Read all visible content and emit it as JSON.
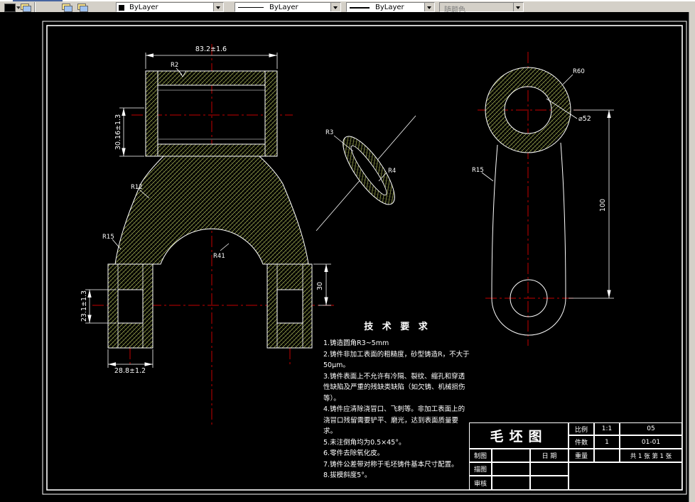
{
  "toolbar": {
    "layer_combo": {
      "label": "ByLayer"
    },
    "linetype_combo": {
      "label": "ByLayer"
    },
    "lineweight_combo": {
      "label": "ByLayer"
    },
    "plotstyle_combo": {
      "label": "随颜色"
    }
  },
  "colors": {
    "centerline": "#c40000",
    "hatch": "#98a24e",
    "outline": "#ffffff",
    "toolbar_bg": "#d4d0c8"
  },
  "tech_requirements": {
    "title": "技 术 要 求",
    "items": [
      "1.铸造圆角R3~5mm",
      "2.铸件非加工表面的粗糙度，砂型铸造R，不大于50μm。",
      "3.铸件表面上不允许有冷隔、裂纹、缩孔和穿透性缺陷及严重的残缺类缺陷（如欠铸、机械损伤等）。",
      "4.铸件应清除浇冒口、飞刺等。非加工表面上的浇冒口残留需要铲平、磨光，达到表面质量要求。",
      "5.未注倒角均为0.5×45°。",
      "6.零件去除氧化皮。",
      "7.铸件公差带对称于毛坯铸件基本尺寸配置。",
      "8.拔模斜度5°。"
    ]
  },
  "dimensions": {
    "top_width": "83.2±1.6",
    "left_height": "30.16±1.3",
    "bore_height": "23.1±1.3",
    "boss_width": "28.8±1.2",
    "right_offset": "30",
    "side_bore_dia": "⌀52",
    "side_height": "100",
    "labels": {
      "r2": "R2",
      "r12": "R12",
      "r15": "R15",
      "r41": "R41",
      "r3": "R3",
      "r4": "R4",
      "r60": "R60",
      "r15b": "R15"
    }
  },
  "title_block": {
    "title": "毛坯图",
    "scale_label": "比例",
    "scale_value": "1:1",
    "qty_label": "件数",
    "qty_value": "1",
    "weight_label": "重量",
    "doc_no_top": "05",
    "doc_no_bottom": "01-01",
    "sheets": "共 1 张  第 1 张",
    "drawn_label": "制图",
    "traced_label": "描图",
    "checked_label": "审核",
    "date_label": "日 期"
  }
}
